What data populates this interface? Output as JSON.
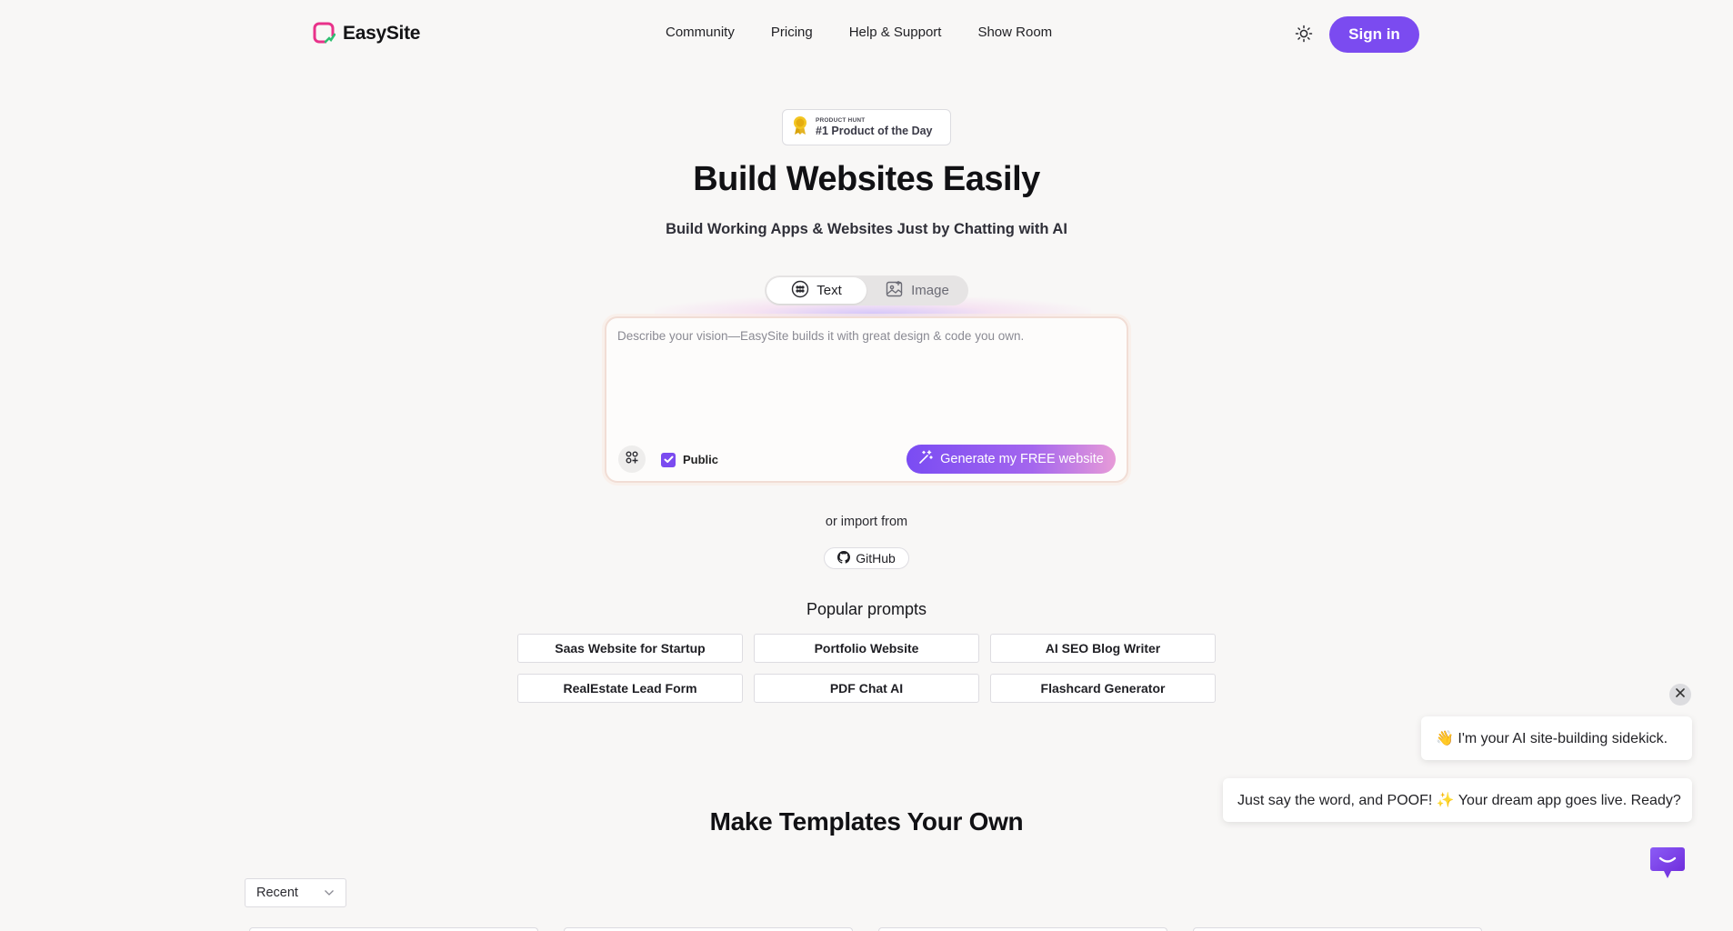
{
  "header": {
    "brand": "EasySite",
    "nav": [
      "Community",
      "Pricing",
      "Help & Support",
      "Show Room"
    ],
    "signin_label": "Sign in"
  },
  "badge": {
    "small_label": "PRODUCT HUNT",
    "main_label": "#1 Product of the Day"
  },
  "hero": {
    "title": "Build Websites Easily",
    "subtitle": "Build Working Apps & Websites Just by Chatting with AI"
  },
  "mode_tabs": [
    {
      "label": "Text",
      "icon": "chat-dots-icon",
      "active": true
    },
    {
      "label": "Image",
      "icon": "image-icon",
      "active": false
    }
  ],
  "prompt": {
    "placeholder": "Describe your vision—EasySite builds it with great design & code you own.",
    "value": "",
    "public_label": "Public",
    "public_checked": true,
    "generate_label": "Generate my FREE website"
  },
  "import": {
    "text": "or import from",
    "github_label": "GitHub"
  },
  "popular": {
    "title": "Popular prompts",
    "items": [
      "Saas Website for Startup",
      "Portfolio Website",
      "AI SEO Blog Writer",
      "RealEstate Lead Form",
      "PDF Chat AI",
      "Flashcard Generator"
    ]
  },
  "templates": {
    "title": "Make Templates Your Own",
    "sort_value": "Recent"
  },
  "chat": {
    "message_1": "👋 I'm your AI site-building sidekick.",
    "message_2": "Just say the word, and POOF! ✨ Your dream app goes live. Ready?"
  },
  "colors": {
    "accent": "#7b4bf0",
    "logo_pink": "#e8328a",
    "logo_green": "#2fbf71",
    "background": "#f8f7f6"
  }
}
